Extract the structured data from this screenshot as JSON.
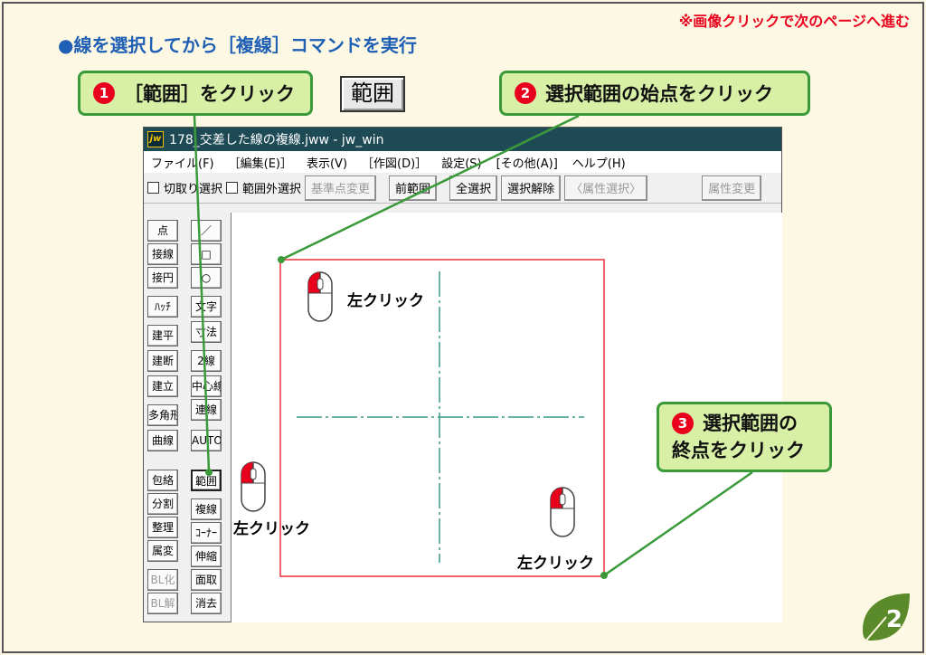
{
  "page": {
    "top_note": "※画像クリックで次のページへ進む",
    "heading": "●線を選択してから［複線］コマンドを実行",
    "page_number": "2"
  },
  "callouts": [
    {
      "num": "❶",
      "text": "［範囲］をクリック"
    },
    {
      "num": "❷",
      "text": "選択範囲の始点をクリック"
    },
    {
      "num": "❸",
      "text_line1": "選択範囲の",
      "text_line2": "終点をクリック"
    }
  ],
  "range_button_big": "範囲",
  "window": {
    "title": "178_交差した線の複線.jww - jw_win",
    "logo": "jw",
    "menu": [
      "ファイル(F)",
      "［編集(E)］",
      "表示(V)",
      "［作図(D)］",
      "設定(S)",
      "[その他(A)]",
      "ヘルプ(H)"
    ],
    "toolbar": {
      "check1": "切取り選択",
      "check2": "範囲外選択",
      "btn_base": "基準点変更",
      "btn_prev": "前範囲",
      "btn_all": "全選択",
      "btn_clear": "選択解除",
      "btn_attrsel": "〈属性選択〉",
      "btn_attrchg": "属性変更"
    },
    "left_col1": [
      "点",
      "接線",
      "接円",
      "ﾊｯﾁ",
      "建平",
      "建断",
      "建立",
      "多角形",
      "曲線",
      "包絡",
      "分割",
      "整理",
      "属変",
      "BL化",
      "BL解"
    ],
    "left_col2": [
      "／",
      "□",
      "○",
      "文字",
      "寸法",
      "2線",
      "中心線",
      "連線",
      "AUTO",
      "範囲",
      "複線",
      "ｺｰﾅｰ",
      "伸縮",
      "面取",
      "消去"
    ]
  },
  "mouse_labels": {
    "left_click": "左クリック"
  },
  "colors": {
    "accent_green": "#3a9a3a",
    "callout_fill": "#d8f0a6",
    "red": "#e8001c",
    "heading_blue": "#1f5fb4",
    "selection_red": "#e8333a",
    "centerline": "#3a9a8a"
  }
}
